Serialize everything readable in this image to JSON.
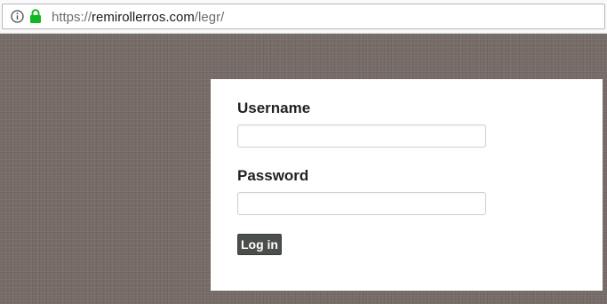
{
  "browser": {
    "url_scheme": "https://",
    "url_host": "remirollerros.com",
    "url_path": "/legr/",
    "secure_icon": "lock-icon",
    "info_icon": "info-icon",
    "secure_color": "#12b524"
  },
  "login_form": {
    "username_label": "Username",
    "username_value": "",
    "password_label": "Password",
    "password_value": "",
    "submit_label": "Log in"
  },
  "colors": {
    "page_background": "#776c67",
    "panel_background": "#ffffff",
    "button_background": "#4a4f4c"
  }
}
